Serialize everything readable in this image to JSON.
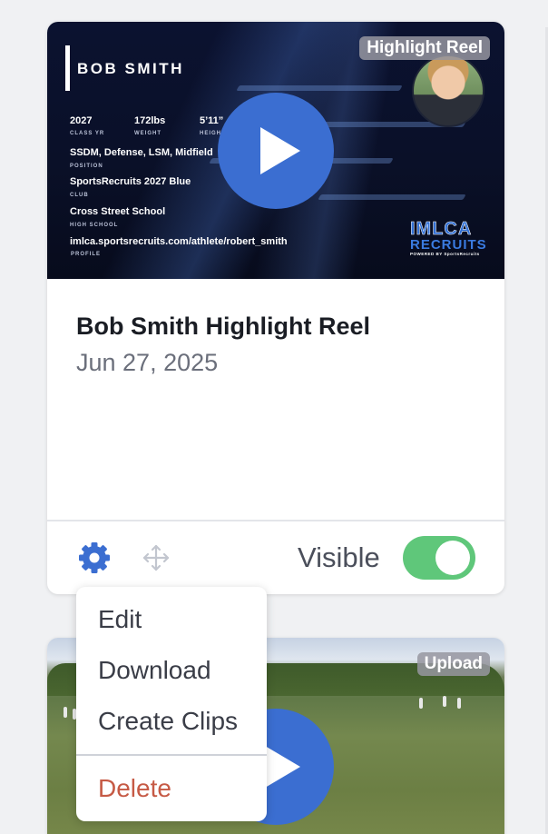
{
  "highlight_card": {
    "badge": "Highlight Reel",
    "thumbnail": {
      "athlete_name": "BOB SMITH",
      "stats": [
        {
          "value": "2027",
          "label": "CLASS YR"
        },
        {
          "value": "172lbs",
          "label": "WEIGHT"
        },
        {
          "value": "5’11”",
          "label": "HEIGHT"
        }
      ],
      "details": [
        {
          "value": "SSDM, Defense, LSM, Midfield",
          "label": "POSITION"
        },
        {
          "value": "SportsRecruits 2027 Blue",
          "label": "CLUB"
        },
        {
          "value": "Cross Street School",
          "label": "HIGH SCHOOL"
        }
      ],
      "profile": {
        "value": "imlca.sportsrecruits.com/athlete/robert_smith",
        "label": "PROFILE"
      },
      "logo": {
        "top": "IMLCA",
        "bottom": "RECRUITS",
        "powered": "POWERED BY SportsRecruits"
      }
    },
    "title": "Bob Smith Highlight Reel",
    "date": "Jun 27, 2025",
    "visibility_label": "Visible",
    "visible": true,
    "toggle_color": "#5fc77a",
    "accent_color": "#3b6ed1"
  },
  "upload_card": {
    "badge": "Upload"
  },
  "menu": {
    "items": [
      "Edit",
      "Download",
      "Create Clips"
    ],
    "delete_label": "Delete",
    "delete_color": "#c65a45"
  }
}
